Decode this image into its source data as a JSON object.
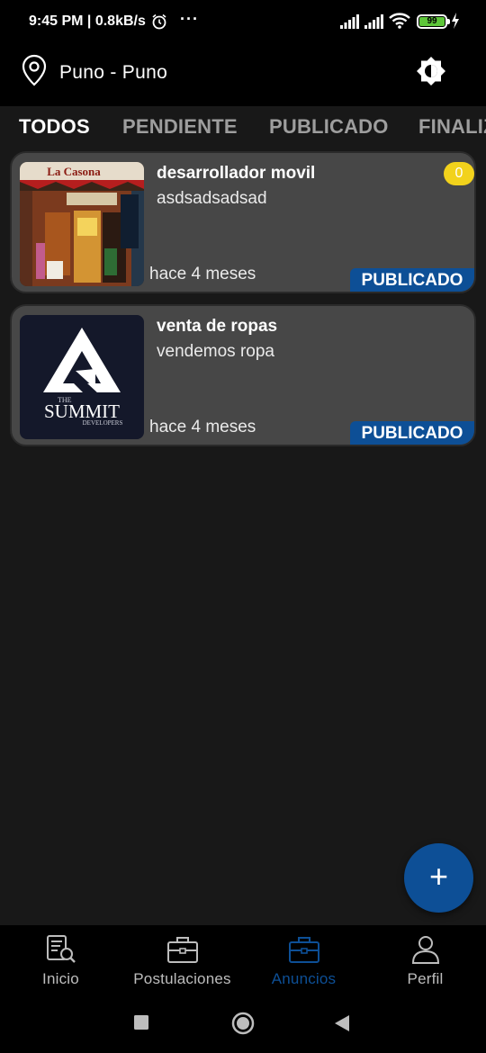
{
  "status_bar": {
    "time": "9:45 PM | 0.8kB/s",
    "dots": "···",
    "battery": "99"
  },
  "location": {
    "text": "Puno - Puno"
  },
  "tabs": [
    {
      "label": "TODOS",
      "active": true
    },
    {
      "label": "PENDIENTE",
      "active": false
    },
    {
      "label": "PUBLICADO",
      "active": false
    },
    {
      "label": "FINALIZ",
      "active": false
    }
  ],
  "cards": [
    {
      "title": "desarrollador movil",
      "description": "asdsadsadsad",
      "time": "hace 4 meses",
      "status": "PUBLICADO",
      "count": "0",
      "image": "restaurant-photo",
      "image_text": "La Casona"
    },
    {
      "title": "venta de ropas",
      "description": "vendemos ropa",
      "time": "hace 4 meses",
      "status": "PUBLICADO",
      "image": "summit-logo",
      "image_text": {
        "the": "THE",
        "name": "SUMMIT",
        "sub": "DEVELOPERS"
      }
    }
  ],
  "fab": {
    "label": "+"
  },
  "bottom_nav": [
    {
      "label": "Inicio",
      "icon": "document-search-icon",
      "active": false
    },
    {
      "label": "Postulaciones",
      "icon": "briefcase-icon",
      "active": false
    },
    {
      "label": "Anuncios",
      "icon": "briefcase-icon",
      "active": true
    },
    {
      "label": "Perfil",
      "icon": "person-icon",
      "active": false
    }
  ],
  "colors": {
    "accent": "#0d4f96",
    "badge_yellow": "#f2d21c",
    "card_bg": "#474747",
    "bg": "#181818"
  }
}
